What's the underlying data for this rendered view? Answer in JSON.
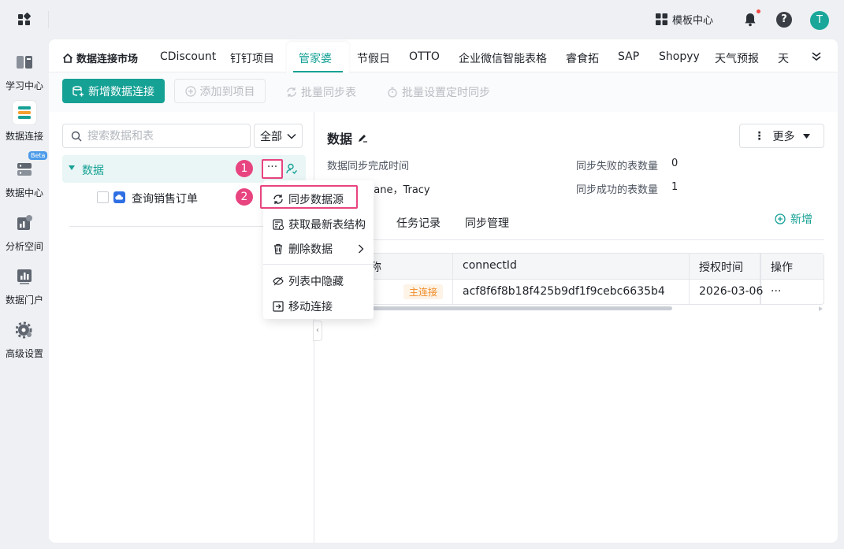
{
  "topbar": {
    "template_center": "模板中心",
    "help": "?",
    "avatar_letter": "T"
  },
  "sidebar": {
    "items": [
      {
        "label": "学习中心",
        "icon": "book-icon"
      },
      {
        "label": "数据连接",
        "icon": "data-connect-icon"
      },
      {
        "label": "数据中心",
        "icon": "server-icon",
        "badge": "Beta"
      },
      {
        "label": "分析空间",
        "icon": "analysis-icon"
      },
      {
        "label": "数据门户",
        "icon": "portal-icon"
      },
      {
        "label": "高级设置",
        "icon": "gear-icon"
      }
    ]
  },
  "tabs": {
    "home": "数据连接市场",
    "items": [
      "CDiscount",
      "钉钉项目",
      "管家婆",
      "节假日",
      "OTTO",
      "企业微信智能表格",
      "睿食拓",
      "SAP",
      "Shopyy",
      "天气预报",
      "天"
    ],
    "active": "管家婆"
  },
  "toolbar": {
    "new_connection": "新增数据连接",
    "add_to_project": "添加到项目",
    "batch_sync": "批量同步表",
    "batch_schedule": "批量设置定时同步"
  },
  "left": {
    "search_placeholder": "搜索数据和表",
    "filter": "全部",
    "tree_node": "数据",
    "child": "查询销售订单",
    "more": "···"
  },
  "badges": {
    "one": "1",
    "two": "2"
  },
  "menu": {
    "sync": "同步数据源",
    "fetch": "获取最新表结构",
    "delete": "删除数据",
    "hide": "列表中隐藏",
    "move": "移动连接"
  },
  "detail": {
    "title": "数据",
    "more_btn": "更多",
    "sync_done_label": "数据同步完成时间",
    "owner_value": "hane，Tracy",
    "fail_label": "同步失败的表数量",
    "fail_value": "0",
    "success_label": "同步成功的表数量",
    "success_value": "1",
    "sub_tabs": [
      "任务记录",
      "同步管理"
    ],
    "add": "新增"
  },
  "table": {
    "headers": [
      "称",
      "connectId",
      "授权时间",
      "操作"
    ],
    "row": {
      "tag": "主连接",
      "connect_id": "acf8f6f8b18f425b9df1f9cebc6635b4",
      "auth_time": "2026-03-06",
      "op": "···"
    }
  }
}
